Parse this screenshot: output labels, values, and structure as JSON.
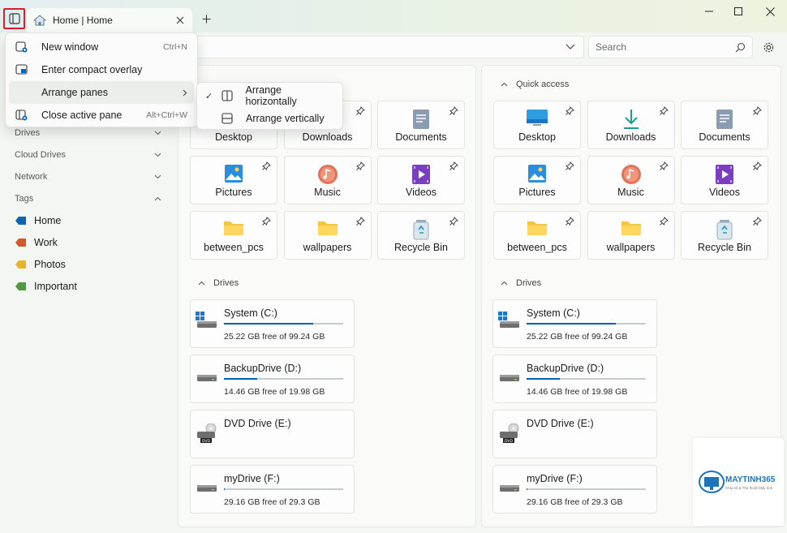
{
  "tab": {
    "title": "Home | Home"
  },
  "search": {
    "placeholder": "Search"
  },
  "menu": {
    "items": [
      {
        "label": "New window",
        "shortcut": "Ctrl+N"
      },
      {
        "label": "Enter compact overlay",
        "shortcut": ""
      },
      {
        "label": "Arrange panes",
        "shortcut": ""
      },
      {
        "label": "Close active pane",
        "shortcut": "Alt+Ctrl+W"
      }
    ],
    "submenu": [
      {
        "label": "Arrange horizontally",
        "checked": true
      },
      {
        "label": "Arrange vertically",
        "checked": false
      }
    ]
  },
  "sidebar": {
    "sections": [
      "Drives",
      "Cloud Drives",
      "Network",
      "Tags"
    ],
    "tags": [
      {
        "label": "Home",
        "color": "#0b63b6"
      },
      {
        "label": "Work",
        "color": "#d05a2c"
      },
      {
        "label": "Photos",
        "color": "#e8b52a"
      },
      {
        "label": "Important",
        "color": "#4e9a3c"
      }
    ]
  },
  "left_pane": {
    "quick_access": [
      "Desktop",
      "Downloads",
      "Documents",
      "Pictures",
      "Music",
      "Videos",
      "between_pcs",
      "wallpapers",
      "Recycle Bin"
    ],
    "drives_title": "Drives",
    "drives": [
      {
        "name": "System (C:)",
        "free": "25.22 GB free of 99.24 GB",
        "used_fraction": 0.75
      },
      {
        "name": "BackupDrive (D:)",
        "free": "14.46 GB free of 19.98 GB",
        "used_fraction": 0.28
      },
      {
        "name": "DVD Drive (E:)",
        "free": "",
        "used_fraction": null
      },
      {
        "name": "myDrive (F:)",
        "free": "29.16 GB free of 29.3 GB",
        "used_fraction": 0.01
      }
    ]
  },
  "right_pane": {
    "quick_access_title": "Quick access",
    "quick_access": [
      "Desktop",
      "Downloads",
      "Documents",
      "Pictures",
      "Music",
      "Videos",
      "between_pcs",
      "wallpapers",
      "Recycle Bin"
    ],
    "drives_title": "Drives",
    "drives": [
      {
        "name": "System (C:)",
        "free": "25.22 GB free of 99.24 GB",
        "used_fraction": 0.75
      },
      {
        "name": "BackupDrive (D:)",
        "free": "14.46 GB free of 19.98 GB",
        "used_fraction": 0.28
      },
      {
        "name": "DVD Drive (E:)",
        "free": "",
        "used_fraction": null
      },
      {
        "name": "myDrive (F:)",
        "free": "29.16 GB free of 29.3 GB",
        "used_fraction": 0.01
      }
    ]
  },
  "watermark": {
    "brand": "MAYTINH365",
    "tagline": "Chia sẻ & Thủ thuật Máy tính"
  }
}
